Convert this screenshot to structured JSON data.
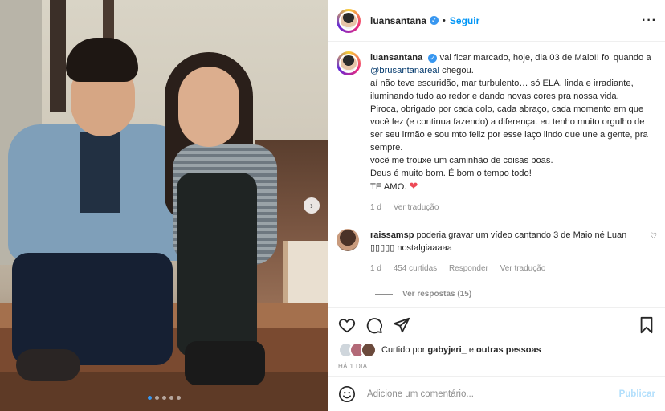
{
  "post": {
    "photo_alt": "Foto antiga de duas crianças sentadas em uma escada",
    "carousel": {
      "count": 5,
      "active": 0
    },
    "colors": {
      "accent": "#0095f6",
      "verified": "#3897f0",
      "like_red": "#ed4956",
      "muted": "#8e8e8e"
    }
  },
  "header": {
    "username": "luansantana",
    "separator": "•",
    "follow_label": "Seguir",
    "more_icon": "more-icon"
  },
  "caption": {
    "username": "luansantana",
    "line1_pre": "vai ficar marcado, hoje, dia 03 de Maio!! foi quando a ",
    "mention": "@brusantanareal",
    "line1_post": " chegou.",
    "body": [
      "aí não teve escuridão, mar turbulento… só ELA, linda e irradiante, iluminando tudo ao redor e dando novas cores pra nossa vida.",
      "Piroca, obrigado por cada colo, cada abraço, cada momento em que você fez (e continua fazendo) a diferença. eu tenho muito orgulho de ser seu irmão e sou mto feliz por esse laço lindo que une a gente, pra sempre.",
      "você me trouxe um caminhão de coisas boas.",
      "Deus é muito bom. É bom o tempo todo!"
    ],
    "last_line": "TE AMO.",
    "time": "1 d",
    "translate": "Ver tradução"
  },
  "comment": {
    "username": "raissamsp",
    "text": "poderia gravar um vídeo cantando 3 de Maio né Luan ▯▯▯▯▯ nostalgiaaaaa",
    "time": "1 d",
    "likes": "454 curtidas",
    "reply": "Responder",
    "translate": "Ver tradução",
    "view_replies": "Ver respostas (15)"
  },
  "actions": {
    "liked_prefix": "Curtido por",
    "liked_user": "gabyjeri_",
    "liked_and": "e",
    "liked_others": "outras pessoas",
    "date": "HÁ 1 DIA"
  },
  "add_comment": {
    "placeholder": "Adicione um comentário...",
    "publish": "Publicar"
  }
}
